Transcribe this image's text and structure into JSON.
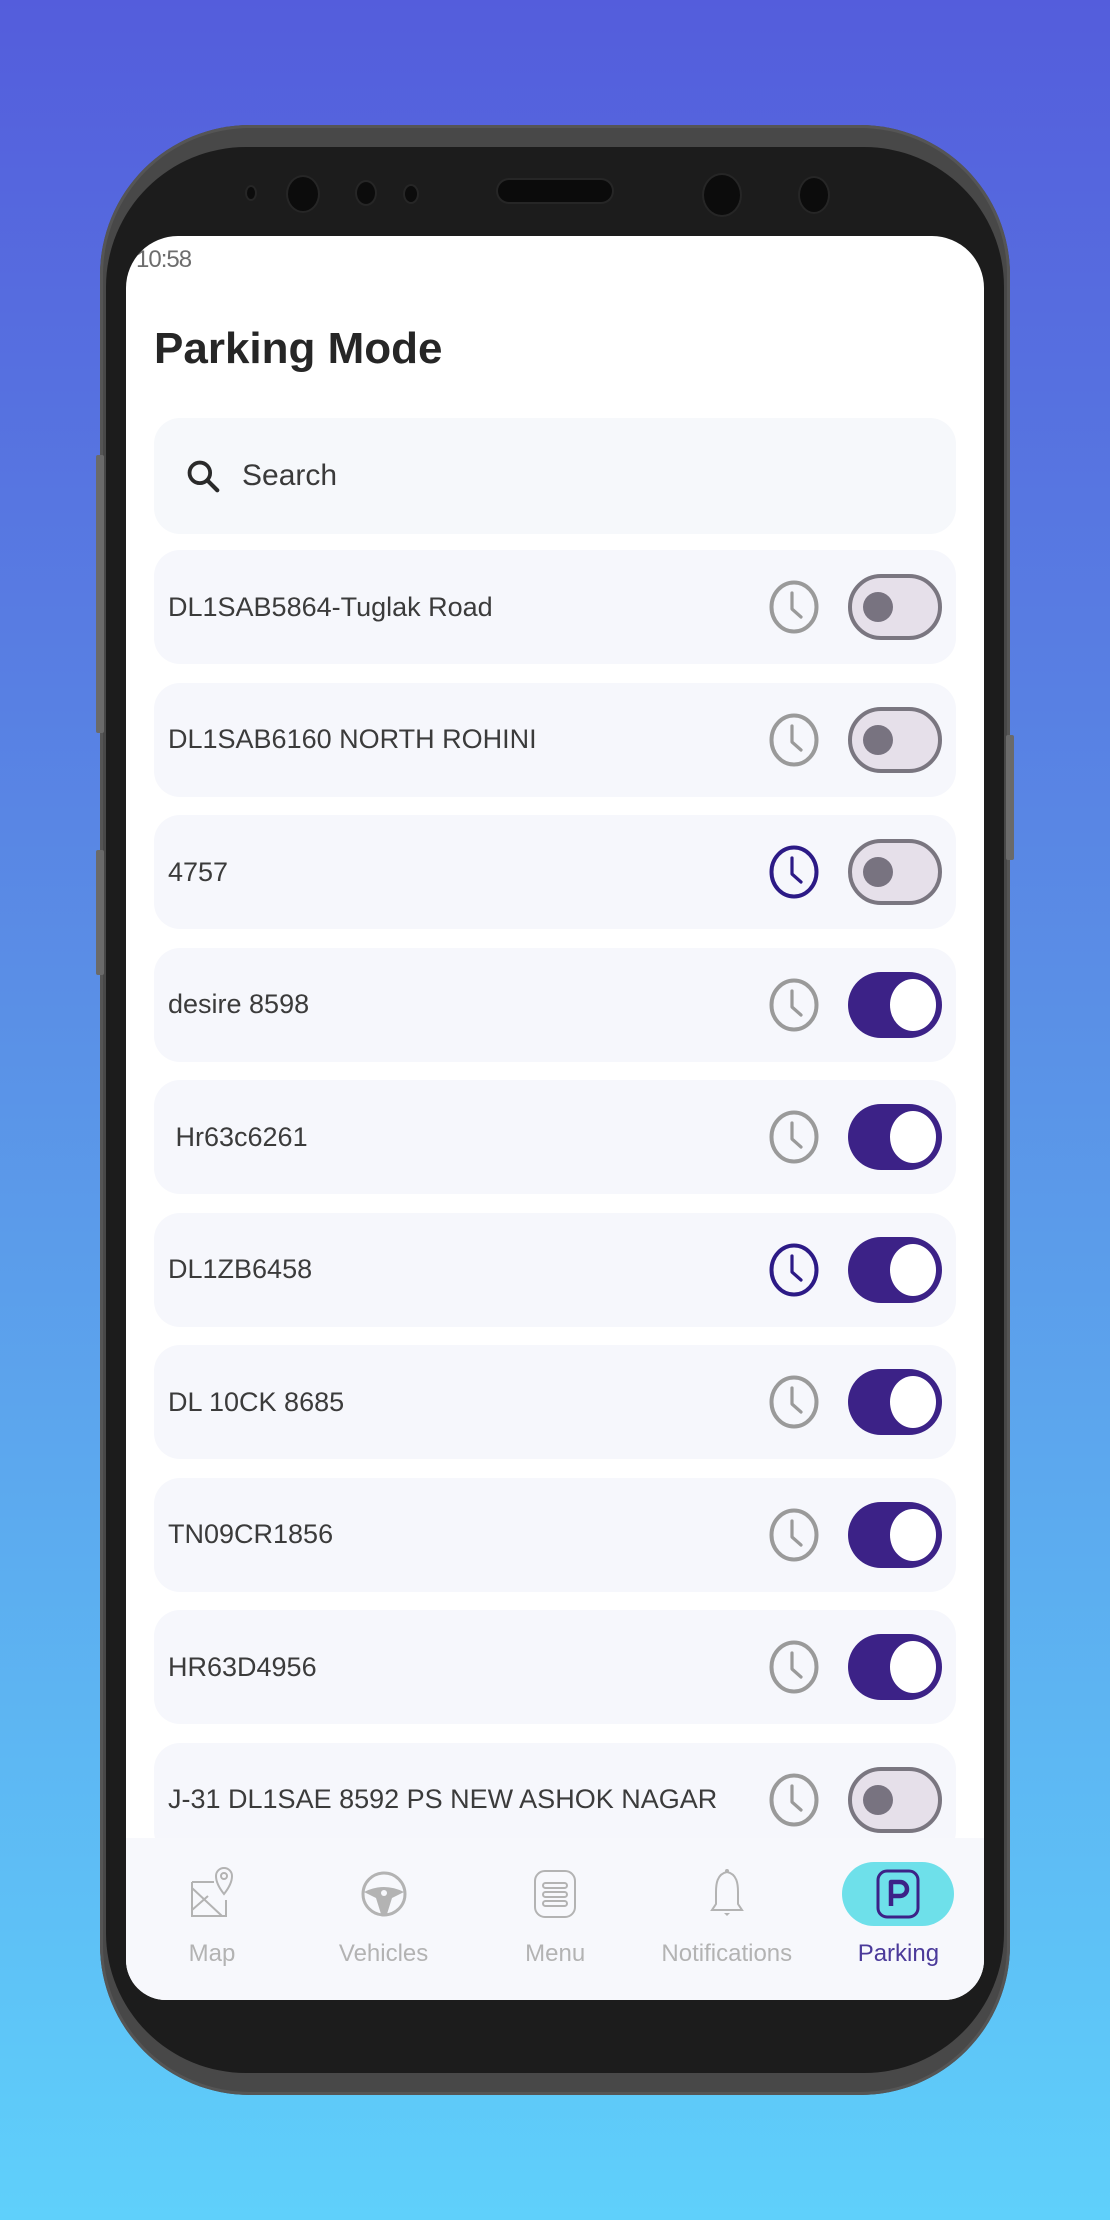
{
  "status_bar": {
    "time": "10:58"
  },
  "header": {
    "title": "Parking Mode"
  },
  "search": {
    "placeholder": "Search",
    "value": "",
    "icon": "search-icon"
  },
  "colors": {
    "accent": "#3c2287",
    "toggle_off_bg": "#e6e0ea",
    "clock_inactive": "#9a9a9a",
    "clock_active": "#2c1a86",
    "nav_active_pill": "#6ee0ea",
    "nav_active_label": "#4b3a9a",
    "nav_inactive": "#b3b3b3"
  },
  "vehicles": [
    {
      "name": "DL1SAB5864-Tuglak Road",
      "schedule_active": false,
      "parking_mode": false
    },
    {
      "name": "DL1SAB6160 NORTH ROHINI",
      "schedule_active": false,
      "parking_mode": false
    },
    {
      "name": "4757",
      "schedule_active": true,
      "parking_mode": false
    },
    {
      "name": "desire 8598",
      "schedule_active": false,
      "parking_mode": true
    },
    {
      "name": " Hr63c6261",
      "schedule_active": false,
      "parking_mode": true
    },
    {
      "name": "DL1ZB6458",
      "schedule_active": true,
      "parking_mode": true
    },
    {
      "name": "DL 10CK 8685",
      "schedule_active": false,
      "parking_mode": true
    },
    {
      "name": "TN09CR1856",
      "schedule_active": false,
      "parking_mode": true
    },
    {
      "name": "HR63D4956",
      "schedule_active": false,
      "parking_mode": true
    },
    {
      "name": "J-31 DL1SAE 8592 PS NEW ASHOK NAGAR",
      "schedule_active": false,
      "parking_mode": false
    }
  ],
  "bottom_nav": {
    "items": [
      {
        "label": "Map",
        "icon": "map-pin-icon",
        "active": false
      },
      {
        "label": "Vehicles",
        "icon": "steering-wheel-icon",
        "active": false
      },
      {
        "label": "Menu",
        "icon": "menu-icon",
        "active": false
      },
      {
        "label": "Notifications",
        "icon": "bell-icon",
        "active": false
      },
      {
        "label": "Parking",
        "icon": "parking-icon",
        "active": true
      }
    ]
  }
}
